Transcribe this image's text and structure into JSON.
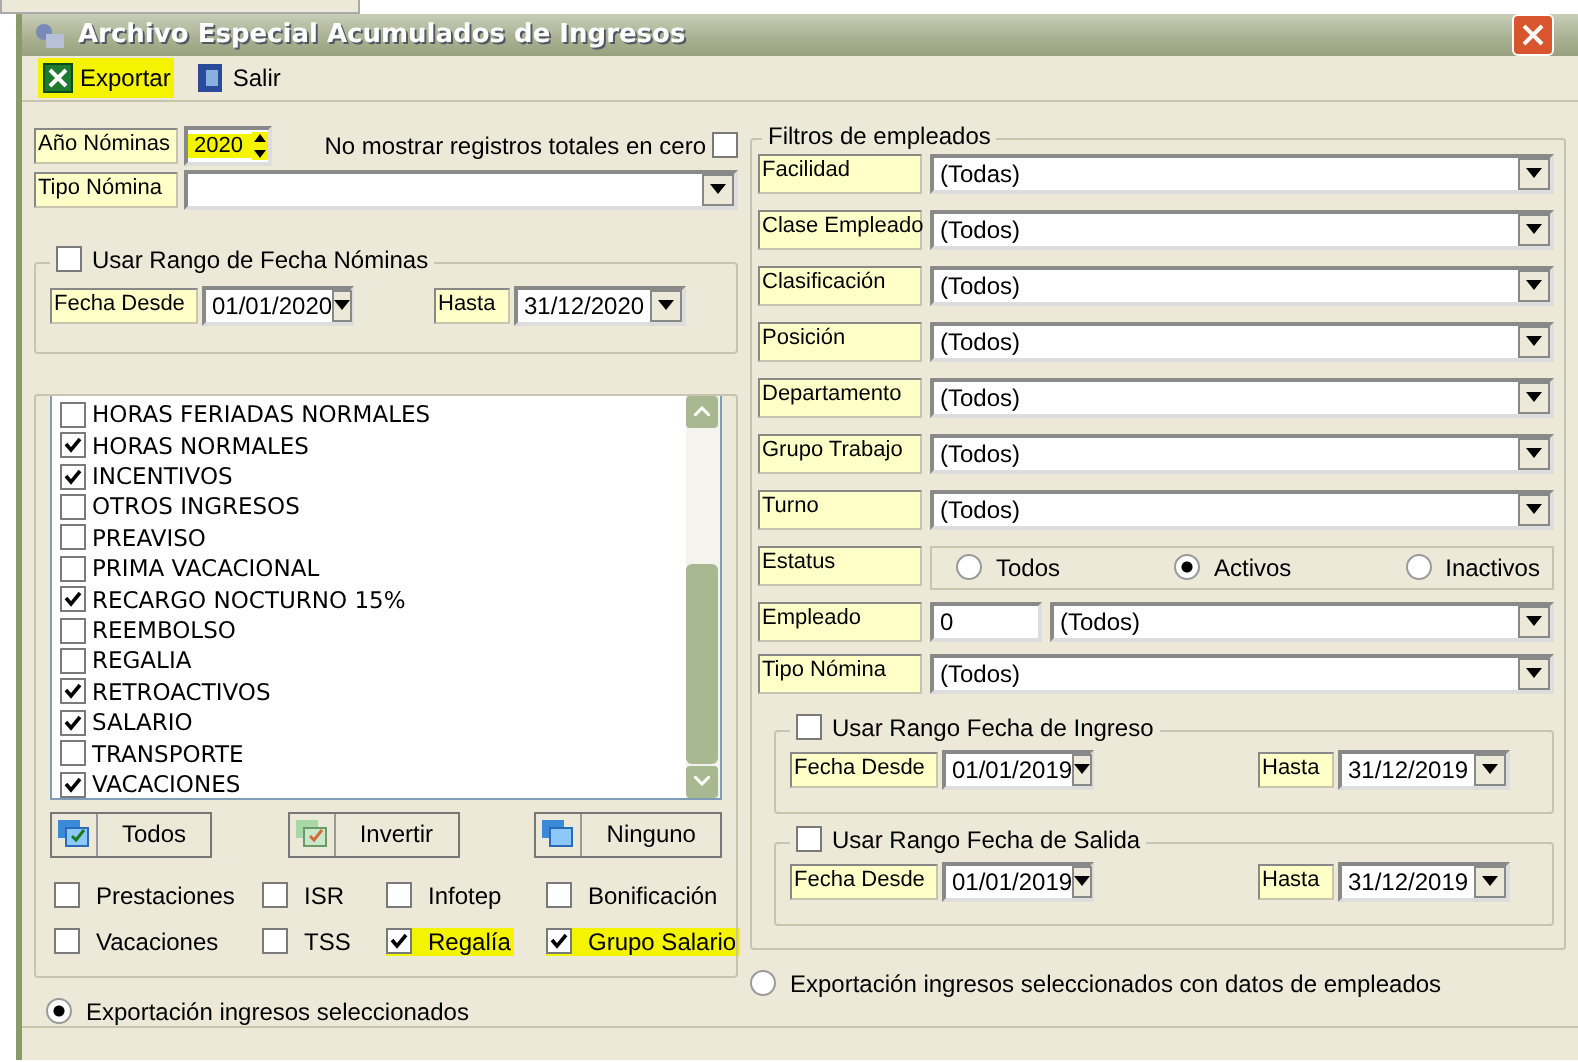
{
  "window": {
    "title": "Archivo Especial Acumulados de Ingresos"
  },
  "toolbar": [
    {
      "label": "Exportar",
      "kind": "excel",
      "highlighted": true
    },
    {
      "label": "Salir",
      "kind": "exit",
      "highlighted": false
    }
  ],
  "year": {
    "label": "Año Nóminas",
    "value": "2020",
    "highlighted": true
  },
  "hide_zero": {
    "label": "No mostrar registros totales en cero",
    "checked": false
  },
  "payroll_type": {
    "label": "Tipo Nómina"
  },
  "payroll_range": {
    "label": "Usar Rango de Fecha Nóminas",
    "checked": false,
    "from_label": "Fecha Desde",
    "from": "01/01/2020",
    "to_label": "Hasta",
    "to": "31/12/2020"
  },
  "income_list": [
    {
      "label": "HORAS FERIADAS NORMALES",
      "checked": false
    },
    {
      "label": "HORAS NORMALES",
      "checked": true
    },
    {
      "label": "INCENTIVOS",
      "checked": true
    },
    {
      "label": "OTROS INGRESOS",
      "checked": false
    },
    {
      "label": "PREAVISO",
      "checked": false
    },
    {
      "label": "PRIMA VACACIONAL",
      "checked": false
    },
    {
      "label": "RECARGO NOCTURNO 15%",
      "checked": true
    },
    {
      "label": "REEMBOLSO",
      "checked": false
    },
    {
      "label": "REGALIA",
      "checked": false
    },
    {
      "label": "RETROACTIVOS",
      "checked": true
    },
    {
      "label": "SALARIO",
      "checked": true
    },
    {
      "label": "TRANSPORTE",
      "checked": false
    },
    {
      "label": "VACACIONES",
      "checked": true
    }
  ],
  "list_buttons": [
    {
      "label": "Todos",
      "kind": "all"
    },
    {
      "label": "Invertir",
      "kind": "invert"
    },
    {
      "label": "Ninguno",
      "kind": "none"
    }
  ],
  "options": [
    {
      "label": "Prestaciones",
      "checked": false,
      "highlighted": false
    },
    {
      "label": "ISR",
      "checked": false,
      "highlighted": false
    },
    {
      "label": "Infotep",
      "checked": false,
      "highlighted": false
    },
    {
      "label": "Bonificación",
      "checked": false,
      "highlighted": false
    },
    {
      "label": "Vacaciones",
      "checked": false,
      "highlighted": false
    },
    {
      "label": "TSS",
      "checked": false,
      "highlighted": false
    },
    {
      "label": "Regalía",
      "checked": true,
      "highlighted": true
    },
    {
      "label": "Grupo Salario",
      "checked": true,
      "highlighted": true
    }
  ],
  "filters": {
    "title": "Filtros de empleados",
    "rows": [
      {
        "label": "Facilidad",
        "kind": "combo",
        "value": "(Todas)"
      },
      {
        "label": "Clase Empleado",
        "kind": "combo",
        "value": "(Todos)"
      },
      {
        "label": "Clasificación",
        "kind": "combo",
        "value": "(Todos)"
      },
      {
        "label": "Posición",
        "kind": "combo",
        "value": "(Todos)"
      },
      {
        "label": "Departamento",
        "kind": "combo",
        "value": "(Todos)"
      },
      {
        "label": "Grupo Trabajo",
        "kind": "combo",
        "value": "(Todos)"
      },
      {
        "label": "Turno",
        "kind": "combo",
        "value": "(Todos)"
      },
      {
        "label": "Estatus",
        "kind": "radios",
        "options": [
          {
            "label": "Todos",
            "selected": false
          },
          {
            "label": "Activos",
            "selected": true
          },
          {
            "label": "Inactivos",
            "selected": false
          }
        ]
      },
      {
        "label": "Empleado",
        "kind": "code",
        "code": "0",
        "value": "(Todos)"
      },
      {
        "label": "Tipo Nómina",
        "kind": "combo",
        "value": "(Todos)"
      }
    ],
    "ranges": [
      {
        "label": "Usar Rango Fecha de Ingreso",
        "checked": false,
        "from_label": "Fecha Desde",
        "from": "01/01/2019",
        "to_label": "Hasta",
        "to": "31/12/2019"
      },
      {
        "label": "Usar Rango Fecha de Salida",
        "checked": false,
        "from_label": "Fecha Desde",
        "from": "01/01/2019",
        "to_label": "Hasta",
        "to": "31/12/2019"
      }
    ]
  },
  "export_mode": [
    {
      "label": "Exportación ingresos seleccionados",
      "selected": true
    },
    {
      "label": "Exportación ingresos seleccionados con datos de empleados",
      "selected": false
    }
  ]
}
